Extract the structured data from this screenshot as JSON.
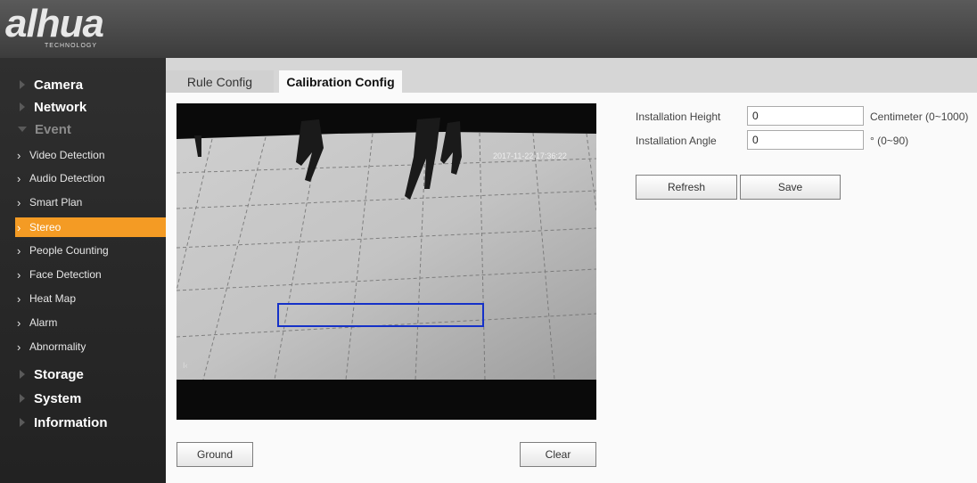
{
  "brand": {
    "logo": "alhua",
    "tagline": "TECHNOLOGY"
  },
  "sidebar": {
    "sections": [
      {
        "label": "Camera"
      },
      {
        "label": "Network"
      },
      {
        "label": "Event"
      },
      {
        "label": "Storage"
      },
      {
        "label": "System"
      },
      {
        "label": "Information"
      }
    ],
    "event_items": [
      {
        "label": "Video Detection"
      },
      {
        "label": "Audio Detection"
      },
      {
        "label": "Smart Plan"
      },
      {
        "label": "Stereo"
      },
      {
        "label": "People Counting"
      },
      {
        "label": "Face Detection"
      },
      {
        "label": "Heat Map"
      },
      {
        "label": "Alarm"
      },
      {
        "label": "Abnormality"
      }
    ],
    "active_item": "Stereo",
    "accent_color": "#f49b24"
  },
  "tabs": [
    {
      "label": "Rule Config",
      "active": false
    },
    {
      "label": "Calibration Config",
      "active": true
    }
  ],
  "video": {
    "timestamp": "2017-11-22 17:36:22",
    "corner_label": "I‹"
  },
  "video_buttons": {
    "ground": "Ground",
    "clear": "Clear"
  },
  "form": {
    "installation_height": {
      "label": "Installation Height",
      "value": "0",
      "unit": "Centimeter (0~1000)"
    },
    "installation_angle": {
      "label": "Installation Angle",
      "value": "0",
      "unit": "° (0~90)"
    }
  },
  "actions": {
    "refresh": "Refresh",
    "save": "Save"
  }
}
